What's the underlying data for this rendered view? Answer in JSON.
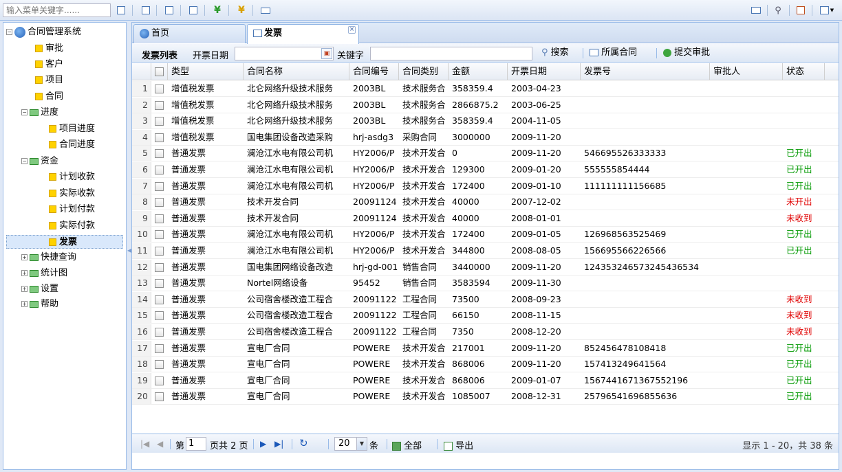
{
  "topbar": {
    "search_placeholder": "输入菜单关键字......"
  },
  "tree": {
    "root": "合同管理系统",
    "items": [
      {
        "label": "审批"
      },
      {
        "label": "客户"
      },
      {
        "label": "项目"
      },
      {
        "label": "合同"
      },
      {
        "label": "进度",
        "children": [
          "项目进度",
          "合同进度"
        ]
      },
      {
        "label": "资金",
        "children": [
          "计划收款",
          "实际收款",
          "计划付款",
          "实际付款",
          "发票"
        ]
      },
      {
        "label": "快捷查询"
      },
      {
        "label": "统计图"
      },
      {
        "label": "设置"
      },
      {
        "label": "帮助"
      }
    ],
    "selected": "发票"
  },
  "tabs": [
    {
      "label": "首页"
    },
    {
      "label": "发票"
    }
  ],
  "grid_toolbar": {
    "title": "发票列表",
    "date_label": "开票日期",
    "keyword_label": "关键字",
    "search_button": "搜索",
    "contract_button": "所属合同",
    "submit_button": "提交审批"
  },
  "columns": [
    "类型",
    "合同名称",
    "合同编号",
    "合同类别",
    "金额",
    "开票日期",
    "发票号",
    "审批人",
    "状态"
  ],
  "rows": [
    {
      "n": "1",
      "type": "增值税发票",
      "name": "北仑网络升级技术服务",
      "code": "2003BL",
      "cat": "技术服务合",
      "amount": "358359.4",
      "date": "2003-04-23",
      "invoice": "",
      "approver": "",
      "status": ""
    },
    {
      "n": "2",
      "type": "增值税发票",
      "name": "北仑网络升级技术服务",
      "code": "2003BL",
      "cat": "技术服务合",
      "amount": "2866875.2",
      "date": "2003-06-25",
      "invoice": "",
      "approver": "",
      "status": ""
    },
    {
      "n": "3",
      "type": "增值税发票",
      "name": "北仑网络升级技术服务",
      "code": "2003BL",
      "cat": "技术服务合",
      "amount": "358359.4",
      "date": "2004-11-05",
      "invoice": "",
      "approver": "",
      "status": ""
    },
    {
      "n": "4",
      "type": "增值税发票",
      "name": "国电集团设备改造采购",
      "code": "hrj-asdg3",
      "cat": "采购合同",
      "amount": "3000000",
      "date": "2009-11-20",
      "invoice": "",
      "approver": "",
      "status": ""
    },
    {
      "n": "5",
      "type": "普通发票",
      "name": "澜沧江水电有限公司机",
      "code": "HY2006/P",
      "cat": "技术开发合",
      "amount": "0",
      "date": "2009-11-20",
      "invoice": "546695526333333",
      "approver": "",
      "status": "已开出"
    },
    {
      "n": "6",
      "type": "普通发票",
      "name": "澜沧江水电有限公司机",
      "code": "HY2006/P",
      "cat": "技术开发合",
      "amount": "129300",
      "date": "2009-01-20",
      "invoice": "555555854444",
      "approver": "",
      "status": "已开出"
    },
    {
      "n": "7",
      "type": "普通发票",
      "name": "澜沧江水电有限公司机",
      "code": "HY2006/P",
      "cat": "技术开发合",
      "amount": "172400",
      "date": "2009-01-10",
      "invoice": "111111111156685",
      "approver": "",
      "status": "已开出"
    },
    {
      "n": "8",
      "type": "普通发票",
      "name": "技术开发合同",
      "code": "20091124",
      "cat": "技术开发合",
      "amount": "40000",
      "date": "2007-12-02",
      "invoice": "",
      "approver": "",
      "status": "未开出"
    },
    {
      "n": "9",
      "type": "普通发票",
      "name": "技术开发合同",
      "code": "20091124",
      "cat": "技术开发合",
      "amount": "40000",
      "date": "2008-01-01",
      "invoice": "",
      "approver": "",
      "status": "未收到"
    },
    {
      "n": "10",
      "type": "普通发票",
      "name": "澜沧江水电有限公司机",
      "code": "HY2006/P",
      "cat": "技术开发合",
      "amount": "172400",
      "date": "2009-01-05",
      "invoice": "126968563525469",
      "approver": "",
      "status": "已开出"
    },
    {
      "n": "11",
      "type": "普通发票",
      "name": "澜沧江水电有限公司机",
      "code": "HY2006/P",
      "cat": "技术开发合",
      "amount": "344800",
      "date": "2008-08-05",
      "invoice": "156695566226566",
      "approver": "",
      "status": "已开出"
    },
    {
      "n": "12",
      "type": "普通发票",
      "name": "国电集团网络设备改造",
      "code": "hrj-gd-001",
      "cat": "销售合同",
      "amount": "3440000",
      "date": "2009-11-20",
      "invoice": "124353246573245436534",
      "approver": "",
      "status": ""
    },
    {
      "n": "13",
      "type": "普通发票",
      "name": "Nortel网络设备",
      "code": "95452",
      "cat": "销售合同",
      "amount": "3583594",
      "date": "2009-11-30",
      "invoice": "",
      "approver": "",
      "status": ""
    },
    {
      "n": "14",
      "type": "普通发票",
      "name": "公司宿舍楼改造工程合",
      "code": "20091122",
      "cat": "工程合同",
      "amount": "73500",
      "date": "2008-09-23",
      "invoice": "",
      "approver": "",
      "status": "未收到"
    },
    {
      "n": "15",
      "type": "普通发票",
      "name": "公司宿舍楼改造工程合",
      "code": "20091122",
      "cat": "工程合同",
      "amount": "66150",
      "date": "2008-11-15",
      "invoice": "",
      "approver": "",
      "status": "未收到"
    },
    {
      "n": "16",
      "type": "普通发票",
      "name": "公司宿舍楼改造工程合",
      "code": "20091122",
      "cat": "工程合同",
      "amount": "7350",
      "date": "2008-12-20",
      "invoice": "",
      "approver": "",
      "status": "未收到"
    },
    {
      "n": "17",
      "type": "普通发票",
      "name": "宣电厂合同",
      "code": "POWERE",
      "cat": "技术开发合",
      "amount": "217001",
      "date": "2009-11-20",
      "invoice": "852456478108418",
      "approver": "",
      "status": "已开出"
    },
    {
      "n": "18",
      "type": "普通发票",
      "name": "宣电厂合同",
      "code": "POWERE",
      "cat": "技术开发合",
      "amount": "868006",
      "date": "2009-11-20",
      "invoice": "157413249641564",
      "approver": "",
      "status": "已开出"
    },
    {
      "n": "19",
      "type": "普通发票",
      "name": "宣电厂合同",
      "code": "POWERE",
      "cat": "技术开发合",
      "amount": "868006",
      "date": "2009-01-07",
      "invoice": "1567441671367552196",
      "approver": "",
      "status": "已开出"
    },
    {
      "n": "20",
      "type": "普通发票",
      "name": "宣电厂合同",
      "code": "POWERE",
      "cat": "技术开发合",
      "amount": "1085007",
      "date": "2008-12-31",
      "invoice": "25796541696855636",
      "approver": "",
      "status": "已开出"
    }
  ],
  "pager": {
    "page_prefix": "第",
    "page": "1",
    "page_suffix": "页共 2 页",
    "page_size": "20",
    "size_unit": "条",
    "all_button": "全部",
    "export_button": "导出",
    "summary": "显示 1 - 20，共 38 条"
  },
  "colors": {
    "status_green": "#009900",
    "status_red": "#e00000",
    "border_blue": "#99bbe8"
  }
}
